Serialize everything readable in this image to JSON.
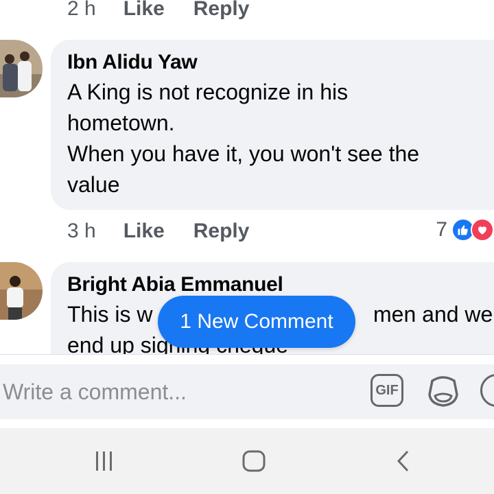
{
  "prev_meta": {
    "time": "2 h",
    "like": "Like",
    "reply": "Reply"
  },
  "comment1": {
    "author": "Ibn Alidu Yaw",
    "text": "A King is not recognize in his\nhometown.\nWhen you have it, you won't see the\nvalue",
    "time": "3 h",
    "like": "Like",
    "reply": "Reply",
    "reaction_count": "7"
  },
  "comment2": {
    "author": "Bright Abia Emmanuel",
    "text_left": "This is w",
    "text_right": "men and we",
    "text_line2": "end up signing cheque"
  },
  "new_comment_pill": "1 New Comment",
  "composer": {
    "placeholder": "Write a comment...",
    "gif_label": "GIF"
  },
  "icons": {
    "like": "thumbs-up-icon",
    "love": "heart-icon",
    "sticker": "sticker-icon",
    "emoji": "emoji-icon",
    "recents": "recents-icon",
    "home": "home-icon",
    "back": "back-icon"
  },
  "colors": {
    "accent": "#1877f2",
    "love": "#f33e58",
    "bubble": "#f0f2f5",
    "meta": "#555a60"
  }
}
